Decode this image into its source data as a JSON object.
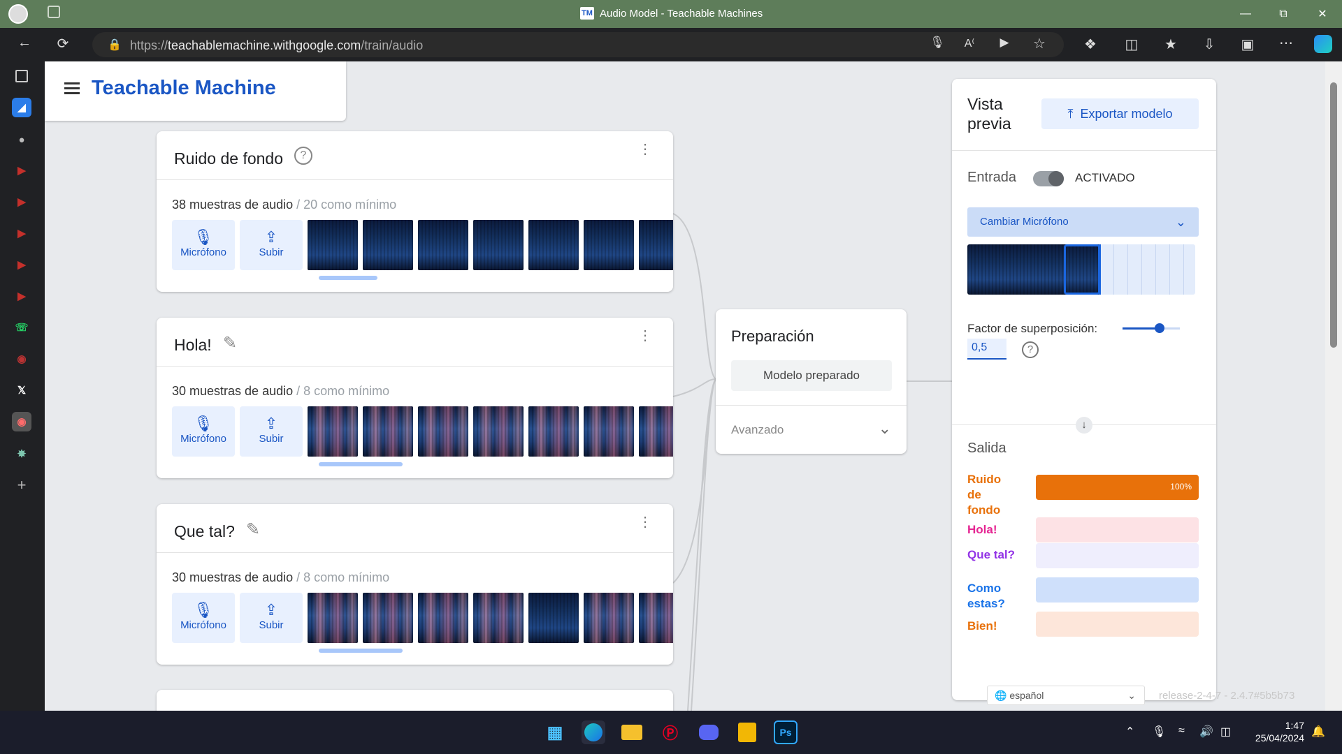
{
  "window": {
    "title": "Audio Model - Teachable Machines",
    "tab_logo": "TM"
  },
  "browser": {
    "url_prefix": "https://",
    "url_host": "teachablemachine.withgoogle.com",
    "url_path": "/train/audio"
  },
  "app": {
    "brand": "Teachable Machine"
  },
  "classes": [
    {
      "name": "Ruido de fondo",
      "icon": "help-circle-icon",
      "samples": "38 muestras de audio",
      "minimum": " / 20 como mínimo",
      "style": "bg"
    },
    {
      "name": "Hola!",
      "icon": "pencil-icon",
      "samples": "30 muestras de audio",
      "minimum": " / 8 como mínimo",
      "style": "b"
    },
    {
      "name": "Que tal?",
      "icon": "pencil-icon",
      "samples": "30 muestras de audio",
      "minimum": " / 8 como mínimo",
      "style": "b"
    }
  ],
  "buttons": {
    "mic": "Micrófono",
    "upload": "Subir"
  },
  "prep": {
    "title": "Preparación",
    "button": "Modelo preparado",
    "advanced": "Avanzado"
  },
  "preview": {
    "title": "Vista previa",
    "export": "Exportar modelo",
    "input_label": "Entrada",
    "toggle_state": "ACTIVADO",
    "mic_select": "Cambiar Micrófono",
    "overlap_label": "Factor de superposición:",
    "overlap_value": "0,5",
    "output_label": "Salida",
    "outputs": [
      {
        "label": "Ruido de fondo",
        "value": 1.0,
        "percent": "100%",
        "color": "#e8710a",
        "bg": "#fde3cd"
      },
      {
        "label": "Hola!",
        "value": 0.0,
        "percent": "",
        "color": "#e52592",
        "bg": "#fde2e5"
      },
      {
        "label": "Que tal?",
        "value": 0.0,
        "percent": "",
        "color": "#9334e6",
        "bg": "#efeefd"
      },
      {
        "label": "Como estas?",
        "value": 0.0,
        "percent": "",
        "color": "#1a73e8",
        "bg": "#cfe0fb"
      },
      {
        "label": "Bien!",
        "value": 0.0,
        "percent": "",
        "color": "#e8710a",
        "bg": "#fde6da"
      }
    ]
  },
  "footer": {
    "language": "español",
    "release": "release-2-4-7 - 2.4.7#5b5b73"
  },
  "clock": {
    "time": "1:47",
    "date": "25/04/2024"
  }
}
